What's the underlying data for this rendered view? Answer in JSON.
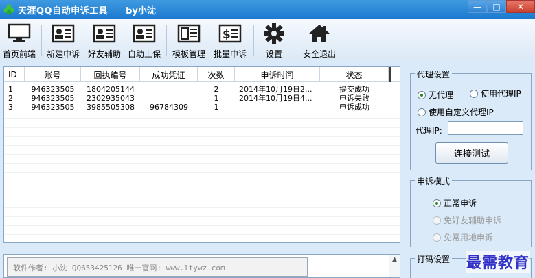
{
  "window": {
    "title": "天涯QQ自动申诉工具",
    "author_tag": "by小沈",
    "controls": {
      "minimize": "—",
      "maximize": "□",
      "close": "✕"
    }
  },
  "toolbar": {
    "items": [
      {
        "label": "首页前端",
        "icon": "monitor-icon"
      },
      {
        "label": "新建申诉",
        "icon": "id-card-icon"
      },
      {
        "label": "好友辅助",
        "icon": "id-card-icon"
      },
      {
        "label": "自助上保",
        "icon": "id-card-icon"
      },
      {
        "label": "模板管理",
        "icon": "template-icon"
      },
      {
        "label": "批量申诉",
        "icon": "dollar-doc-icon"
      },
      {
        "label": "设置",
        "icon": "gear-icon"
      },
      {
        "label": "安全退出",
        "icon": "home-icon"
      }
    ]
  },
  "grid": {
    "columns": [
      "ID",
      "账号",
      "回执编号",
      "成功凭证",
      "次数",
      "申诉时间",
      "状态"
    ],
    "rows": [
      {
        "id": "1",
        "account": "946323505",
        "receipt": "1804205144",
        "cert": "",
        "count": "2",
        "time": "2014年10月19日2...",
        "status": "提交成功"
      },
      {
        "id": "2",
        "account": "946323505",
        "receipt": "2302935043",
        "cert": "",
        "count": "1",
        "time": "2014年10月19日4...",
        "status": "申诉失败"
      },
      {
        "id": "3",
        "account": "946323505",
        "receipt": "3985505308",
        "cert": "96784309",
        "count": "1",
        "time": "",
        "status": "申诉成功"
      }
    ]
  },
  "proxy": {
    "title": "代理设置",
    "options": {
      "none": "无代理",
      "use": "使用代理IP",
      "custom": "使用自定义代理IP"
    },
    "selected": "none",
    "ip_label": "代理IP:",
    "ip_value": "",
    "test_button": "连接测试"
  },
  "appeal_mode": {
    "title": "申诉模式",
    "options": {
      "normal": "正常申诉",
      "no_friend": "免好友辅助申诉",
      "no_location": "免常用地申诉"
    },
    "selected": "normal"
  },
  "captcha": {
    "title": "打码设置"
  },
  "log": {
    "text": "软件作者: 小沈  QQ653425126  唯一官网: www.ltywz.com"
  },
  "watermark": "最需教育",
  "colors": {
    "titlebar": "#2a86d8",
    "background": "#dbeaf8",
    "accent_green": "#1d8a1d"
  }
}
